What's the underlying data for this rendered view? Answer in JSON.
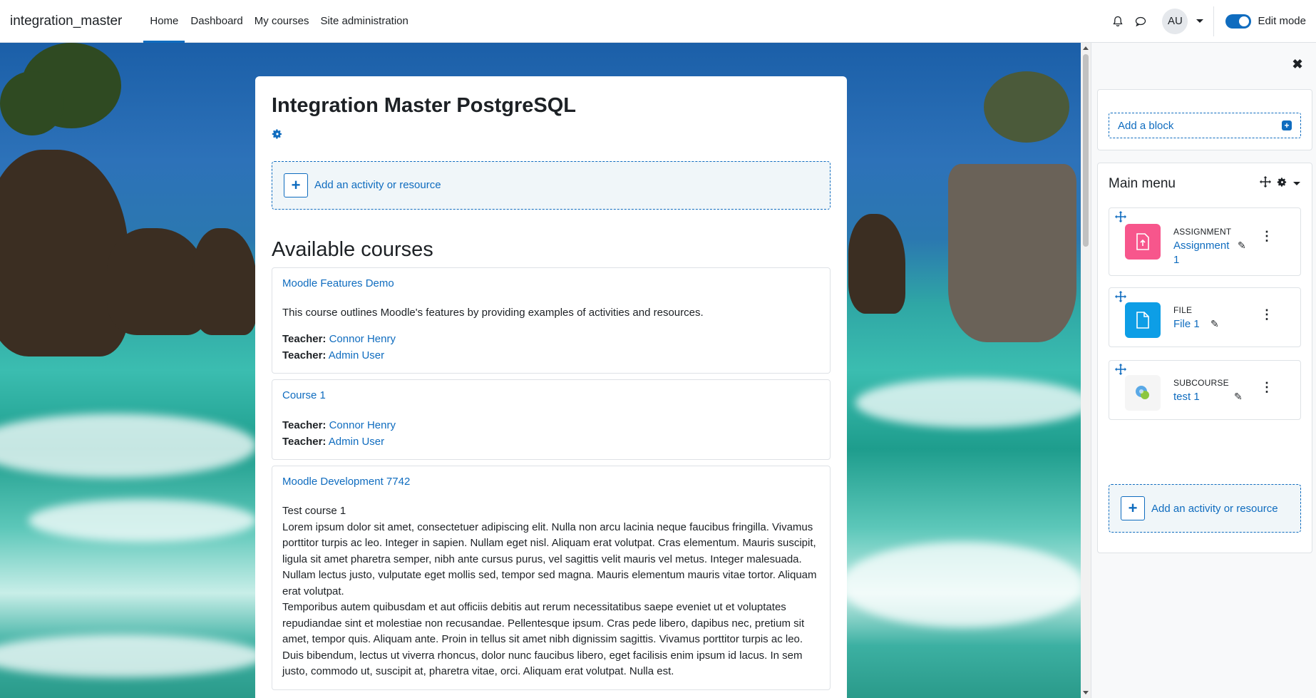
{
  "navbar": {
    "brand": "integration_master",
    "items": [
      {
        "label": "Home",
        "active": true
      },
      {
        "label": "Dashboard"
      },
      {
        "label": "My courses"
      },
      {
        "label": "Site administration"
      }
    ],
    "avatar_initials": "AU",
    "edit_mode_label": "Edit mode",
    "edit_mode_on": true
  },
  "main": {
    "title": "Integration Master PostgreSQL",
    "add_activity_label": "Add an activity or resource",
    "available_courses_title": "Available courses",
    "courses": [
      {
        "name": "Moodle Features Demo",
        "summary": "This course outlines Moodle's features by providing examples of activities and resources.",
        "teacher_label": "Teacher:",
        "teachers": [
          "Connor Henry",
          "Admin User"
        ]
      },
      {
        "name": "Course 1",
        "teacher_label": "Teacher:",
        "teachers": [
          "Connor Henry",
          "Admin User"
        ]
      },
      {
        "name": "Moodle Development 7742",
        "summary_heading": "Test course 1",
        "summary_p1": "Lorem ipsum dolor sit amet, consectetuer adipiscing elit. Nulla non arcu lacinia neque faucibus fringilla. Vivamus porttitor turpis ac leo. Integer in sapien. Nullam eget nisl. Aliquam erat volutpat. Cras elementum. Mauris suscipit, ligula sit amet pharetra semper, nibh ante cursus purus, vel sagittis velit mauris vel metus. Integer malesuada. Nullam lectus justo, vulputate eget mollis sed, tempor sed magna. Mauris elementum mauris vitae tortor. Aliquam erat volutpat.",
        "summary_p2": "Temporibus autem quibusdam et aut officiis debitis aut rerum necessitatibus saepe eveniet ut et voluptates repudiandae sint et molestiae non recusandae. Pellentesque ipsum. Cras pede libero, dapibus nec, pretium sit amet, tempor quis. Aliquam ante. Proin in tellus sit amet nibh dignissim sagittis. Vivamus porttitor turpis ac leo. Duis bibendum, lectus ut viverra rhoncus, dolor nunc faucibus libero, eget facilisis enim ipsum id lacus. In sem justo, commodo ut, suscipit at, pharetra vitae, orci. Aliquam erat volutpat. Nulla est."
      }
    ]
  },
  "drawer": {
    "add_block_label": "Add a block",
    "main_menu_title": "Main menu",
    "activities": [
      {
        "type": "ASSIGNMENT",
        "name_line1": "Assignment",
        "name_line2": "1",
        "color": "#f7568c",
        "icon": "assignment-icon"
      },
      {
        "type": "FILE",
        "name_line1": "File 1",
        "color": "#0d9ee6",
        "icon": "file-icon"
      },
      {
        "type": "SUBCOURSE",
        "name_line1": "test 1",
        "color": "#f5f5f5",
        "icon": "subcourse-icon"
      }
    ],
    "add_activity_label": "Add an activity or resource"
  },
  "colors": {
    "primary": "#0f6cbf",
    "assignment": "#f7568c",
    "file": "#0d9ee6"
  }
}
